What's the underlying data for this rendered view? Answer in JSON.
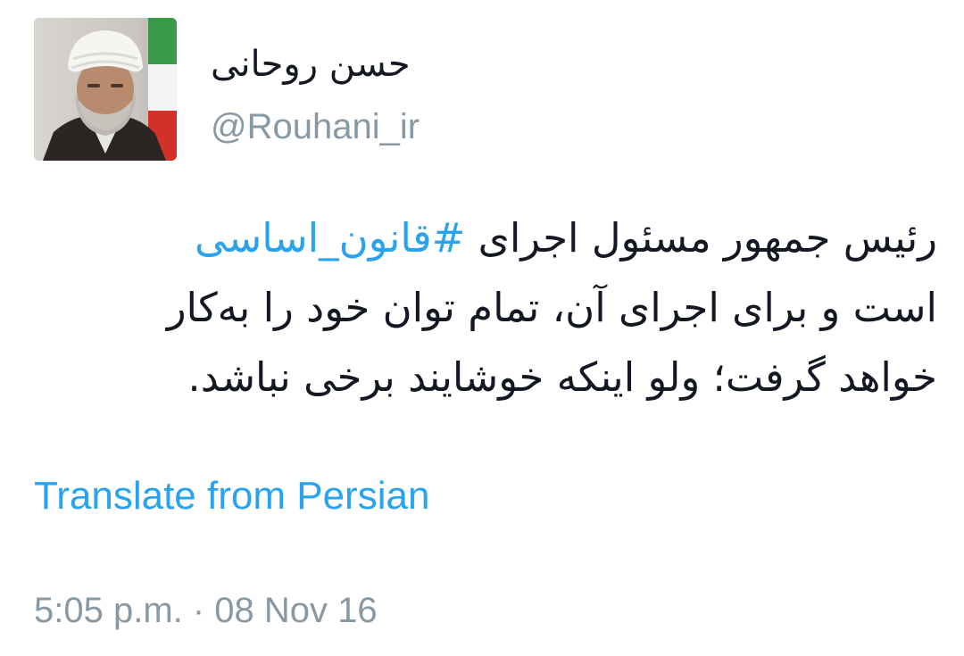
{
  "author": {
    "display_name": "حسن روحانی",
    "handle": "@Rouhani_ir",
    "avatar_icon": "profile-photo"
  },
  "tweet": {
    "line1_text": "رئیس جمهور مسئول اجرای ",
    "line1_hashtag": "#قانون_اساسی",
    "line2_text": "است و برای اجرای آن، تمام توان خود را به‌کار",
    "line3_text": "خواهد گرفت؛ ولو اینکه خوشایند برخی نباشد."
  },
  "translate_link": "Translate from Persian",
  "timestamp": "5:05 p.m. · 08 Nov 16",
  "colors": {
    "link": "#2aa3ef",
    "muted": "#8899a6",
    "text": "#141823"
  }
}
